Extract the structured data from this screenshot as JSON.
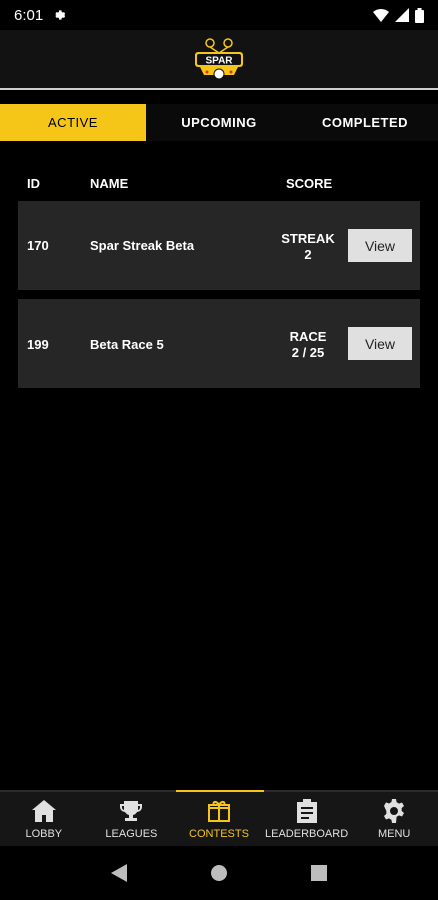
{
  "status_bar": {
    "time": "6:01"
  },
  "header": {
    "logo_text": "SPAR"
  },
  "colors": {
    "accent": "#f5c518",
    "row_bg": "#262626",
    "background": "#000000"
  },
  "tabs": [
    {
      "label": "ACTIVE",
      "active": true
    },
    {
      "label": "UPCOMING",
      "active": false
    },
    {
      "label": "COMPLETED",
      "active": false
    }
  ],
  "table": {
    "headers": {
      "id": "ID",
      "name": "NAME",
      "score": "SCORE"
    },
    "rows": [
      {
        "id": "170",
        "name": "Spar Streak Beta",
        "score_line1": "STREAK",
        "score_line2": "2",
        "button": "View"
      },
      {
        "id": "199",
        "name": "Beta Race 5",
        "score_line1": "RACE",
        "score_line2": "2 / 25",
        "button": "View"
      }
    ]
  },
  "bottom_nav": [
    {
      "label": "LOBBY",
      "icon": "home-icon",
      "active": false
    },
    {
      "label": "LEAGUES",
      "icon": "trophy-icon",
      "active": false
    },
    {
      "label": "CONTESTS",
      "icon": "gift-icon",
      "active": true
    },
    {
      "label": "LEADERBOARD",
      "icon": "clipboard-icon",
      "active": false
    },
    {
      "label": "MENU",
      "icon": "gear-icon",
      "active": false
    }
  ]
}
